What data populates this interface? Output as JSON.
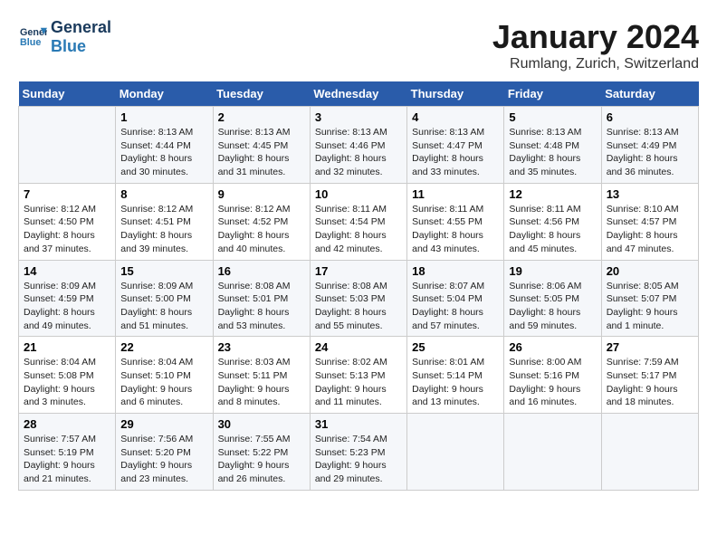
{
  "header": {
    "logo_line1": "General",
    "logo_line2": "Blue",
    "title": "January 2024",
    "subtitle": "Rumlang, Zurich, Switzerland"
  },
  "calendar": {
    "weekdays": [
      "Sunday",
      "Monday",
      "Tuesday",
      "Wednesday",
      "Thursday",
      "Friday",
      "Saturday"
    ],
    "weeks": [
      [
        {
          "day": "",
          "info": ""
        },
        {
          "day": "1",
          "info": "Sunrise: 8:13 AM\nSunset: 4:44 PM\nDaylight: 8 hours\nand 30 minutes."
        },
        {
          "day": "2",
          "info": "Sunrise: 8:13 AM\nSunset: 4:45 PM\nDaylight: 8 hours\nand 31 minutes."
        },
        {
          "day": "3",
          "info": "Sunrise: 8:13 AM\nSunset: 4:46 PM\nDaylight: 8 hours\nand 32 minutes."
        },
        {
          "day": "4",
          "info": "Sunrise: 8:13 AM\nSunset: 4:47 PM\nDaylight: 8 hours\nand 33 minutes."
        },
        {
          "day": "5",
          "info": "Sunrise: 8:13 AM\nSunset: 4:48 PM\nDaylight: 8 hours\nand 35 minutes."
        },
        {
          "day": "6",
          "info": "Sunrise: 8:13 AM\nSunset: 4:49 PM\nDaylight: 8 hours\nand 36 minutes."
        }
      ],
      [
        {
          "day": "7",
          "info": "Sunrise: 8:12 AM\nSunset: 4:50 PM\nDaylight: 8 hours\nand 37 minutes."
        },
        {
          "day": "8",
          "info": "Sunrise: 8:12 AM\nSunset: 4:51 PM\nDaylight: 8 hours\nand 39 minutes."
        },
        {
          "day": "9",
          "info": "Sunrise: 8:12 AM\nSunset: 4:52 PM\nDaylight: 8 hours\nand 40 minutes."
        },
        {
          "day": "10",
          "info": "Sunrise: 8:11 AM\nSunset: 4:54 PM\nDaylight: 8 hours\nand 42 minutes."
        },
        {
          "day": "11",
          "info": "Sunrise: 8:11 AM\nSunset: 4:55 PM\nDaylight: 8 hours\nand 43 minutes."
        },
        {
          "day": "12",
          "info": "Sunrise: 8:11 AM\nSunset: 4:56 PM\nDaylight: 8 hours\nand 45 minutes."
        },
        {
          "day": "13",
          "info": "Sunrise: 8:10 AM\nSunset: 4:57 PM\nDaylight: 8 hours\nand 47 minutes."
        }
      ],
      [
        {
          "day": "14",
          "info": "Sunrise: 8:09 AM\nSunset: 4:59 PM\nDaylight: 8 hours\nand 49 minutes."
        },
        {
          "day": "15",
          "info": "Sunrise: 8:09 AM\nSunset: 5:00 PM\nDaylight: 8 hours\nand 51 minutes."
        },
        {
          "day": "16",
          "info": "Sunrise: 8:08 AM\nSunset: 5:01 PM\nDaylight: 8 hours\nand 53 minutes."
        },
        {
          "day": "17",
          "info": "Sunrise: 8:08 AM\nSunset: 5:03 PM\nDaylight: 8 hours\nand 55 minutes."
        },
        {
          "day": "18",
          "info": "Sunrise: 8:07 AM\nSunset: 5:04 PM\nDaylight: 8 hours\nand 57 minutes."
        },
        {
          "day": "19",
          "info": "Sunrise: 8:06 AM\nSunset: 5:05 PM\nDaylight: 8 hours\nand 59 minutes."
        },
        {
          "day": "20",
          "info": "Sunrise: 8:05 AM\nSunset: 5:07 PM\nDaylight: 9 hours\nand 1 minute."
        }
      ],
      [
        {
          "day": "21",
          "info": "Sunrise: 8:04 AM\nSunset: 5:08 PM\nDaylight: 9 hours\nand 3 minutes."
        },
        {
          "day": "22",
          "info": "Sunrise: 8:04 AM\nSunset: 5:10 PM\nDaylight: 9 hours\nand 6 minutes."
        },
        {
          "day": "23",
          "info": "Sunrise: 8:03 AM\nSunset: 5:11 PM\nDaylight: 9 hours\nand 8 minutes."
        },
        {
          "day": "24",
          "info": "Sunrise: 8:02 AM\nSunset: 5:13 PM\nDaylight: 9 hours\nand 11 minutes."
        },
        {
          "day": "25",
          "info": "Sunrise: 8:01 AM\nSunset: 5:14 PM\nDaylight: 9 hours\nand 13 minutes."
        },
        {
          "day": "26",
          "info": "Sunrise: 8:00 AM\nSunset: 5:16 PM\nDaylight: 9 hours\nand 16 minutes."
        },
        {
          "day": "27",
          "info": "Sunrise: 7:59 AM\nSunset: 5:17 PM\nDaylight: 9 hours\nand 18 minutes."
        }
      ],
      [
        {
          "day": "28",
          "info": "Sunrise: 7:57 AM\nSunset: 5:19 PM\nDaylight: 9 hours\nand 21 minutes."
        },
        {
          "day": "29",
          "info": "Sunrise: 7:56 AM\nSunset: 5:20 PM\nDaylight: 9 hours\nand 23 minutes."
        },
        {
          "day": "30",
          "info": "Sunrise: 7:55 AM\nSunset: 5:22 PM\nDaylight: 9 hours\nand 26 minutes."
        },
        {
          "day": "31",
          "info": "Sunrise: 7:54 AM\nSunset: 5:23 PM\nDaylight: 9 hours\nand 29 minutes."
        },
        {
          "day": "",
          "info": ""
        },
        {
          "day": "",
          "info": ""
        },
        {
          "day": "",
          "info": ""
        }
      ]
    ]
  }
}
